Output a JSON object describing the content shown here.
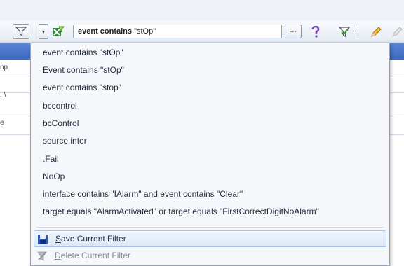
{
  "toolbar": {
    "filter_keyword": "event contains",
    "filter_value": "\"stOp\"",
    "ellipsis_label": "...",
    "dropdown_arrow": "▾"
  },
  "background": {
    "left_cells": [
      "np",
      ": \\",
      "e"
    ]
  },
  "menu": {
    "history": [
      "event contains \"stOp\"",
      "Event contains \"stOp\"",
      "event contains \"stop\"",
      "bccontrol",
      "bcControl",
      "source inter",
      ".Fail",
      "NoOp",
      "interface contains \"IAlarm\" and event contains \"Clear\"",
      "target equals \"AlarmActivated\" or target equals \"FirstCorrectDigitNoAlarm\""
    ],
    "save_accel": "S",
    "save_rest": "ave Current Filter",
    "delete_accel": "D",
    "delete_rest": "elete Current Filter"
  },
  "colors": {
    "accent": "#3d69c0",
    "highlight": "#dde8f8"
  },
  "icons": [
    "filter-icon",
    "excel-filter-icon",
    "question-icon",
    "filter-apply-icon",
    "pencil-icon",
    "save-icon",
    "delete-icon"
  ]
}
